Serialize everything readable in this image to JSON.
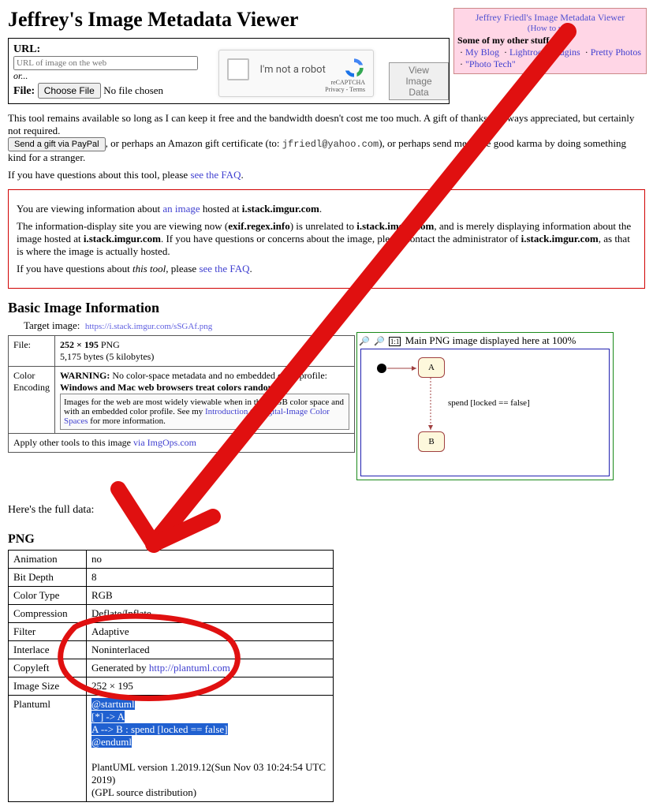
{
  "pageTitle": "Jeffrey's Image Metadata Viewer",
  "pink": {
    "title": "Jeffrey Friedl's Image Metadata Viewer",
    "howto": "(How to use)",
    "otherLabel": "Some of my other stuff",
    "links": [
      "My Blog",
      "Lightroom plugins",
      "Pretty Photos",
      "\"Photo Tech\""
    ]
  },
  "urlbox": {
    "urlLabel": "URL:",
    "placeholder": "URL of image on the web",
    "or": "or...",
    "fileLabel": "File:",
    "chooseBtn": "Choose File",
    "noFile": "No file chosen",
    "captchaText": "I'm not a robot",
    "captchaBrand": "reCAPTCHA",
    "captchaTerms": "Privacy - Terms",
    "viewBtn": "View Image Data"
  },
  "para1a": "This tool remains available so long as I can keep it free and the bandwidth doesn't cost me too much. A gift of thanks is always appreciated, but certainly not required.",
  "sendBtn": "Send a gift via PayPal",
  "para1b": ", or perhaps an Amazon gift certificate (to: ",
  "email": "jfriedl@yahoo.com",
  "para1c": "), or perhaps send me some good karma by doing something kind for a stranger.",
  "qPrefix": "If you have questions about this tool, please ",
  "qLink": "see the FAQ",
  "redbox": {
    "p1a": "You are viewing information about ",
    "p1link": "an image",
    "p1b": " hosted at ",
    "p1host": "i.stack.imgur.com",
    "p2a": "The information-display site you are viewing now (",
    "p2site": "exif.regex.info",
    "p2b": ") is unrelated to ",
    "p2host1": "i.stack.imgur.com",
    "p2c": ", and is merely displaying information about the image hosted at ",
    "p2host2": "i.stack.imgur.com",
    "p2d": ". If you have questions or concerns about the image, please contact the administrator of ",
    "p2host3": "i.stack.imgur.com",
    "p2e": ", as that is where the image is actually hosted.",
    "p3a": "If you have questions about ",
    "p3em": "this tool",
    "p3b": ", please ",
    "p3link": "see the FAQ"
  },
  "basic": {
    "heading": "Basic Image Information",
    "targetLabel": "Target image:",
    "targetUrl": "https://i.stack.imgur.com/sSGAf.png",
    "fileLabel": "File:",
    "fileDims": "252 × 195",
    "fileType": " PNG",
    "fileBytes": "5,175 bytes (5 kilobytes)",
    "colorLabel1": "Color",
    "colorLabel2": "Encoding",
    "warnBold": "WARNING:",
    "warnText": " No color-space metadata and no embedded color profile: ",
    "warnBold2": "Windows and Mac web browsers treat colors randomly",
    "warnSmall1": "Images for the web are most widely viewable when in the sRGB color space and with an embedded color profile. See my ",
    "warnLink": "Introduction to Digital-Image Color Spaces",
    "warnSmall2": " for more information.",
    "applyPrefix": "Apply other tools to this image ",
    "applyLink": "via ImgOps.com"
  },
  "preview": {
    "icon1": "🔎",
    "icon2": "🔎",
    "icon3": "1:1",
    "caption": "Main PNG image displayed here at 100%",
    "nodeA": "A",
    "nodeB": "B",
    "edgeLabel": "spend [locked == false]"
  },
  "fulldata": "Here's the full data:",
  "pngHeading": "PNG",
  "pngRows": [
    {
      "k": "Animation",
      "v": "no"
    },
    {
      "k": "Bit Depth",
      "v": "8"
    },
    {
      "k": "Color Type",
      "v": "RGB"
    },
    {
      "k": "Compression",
      "v": "Deflate/Inflate"
    },
    {
      "k": "Filter",
      "v": "Adaptive"
    },
    {
      "k": "Interlace",
      "v": "Noninterlaced"
    },
    {
      "k": "Image Size",
      "v": "252 × 195"
    }
  ],
  "copyleft": {
    "k": "Copyleft",
    "prefix": "Generated by ",
    "link": "http://plantuml.com"
  },
  "plantuml": {
    "k": "Plantuml",
    "l1": "@startuml",
    "l2": "[*] -> A",
    "l3": "A --> B : spend [locked == false]",
    "l4": "@enduml",
    "version": "PlantUML version 1.2019.12(Sun Nov 03 10:24:54 UTC 2019)",
    "gpl": "(GPL source distribution)"
  }
}
